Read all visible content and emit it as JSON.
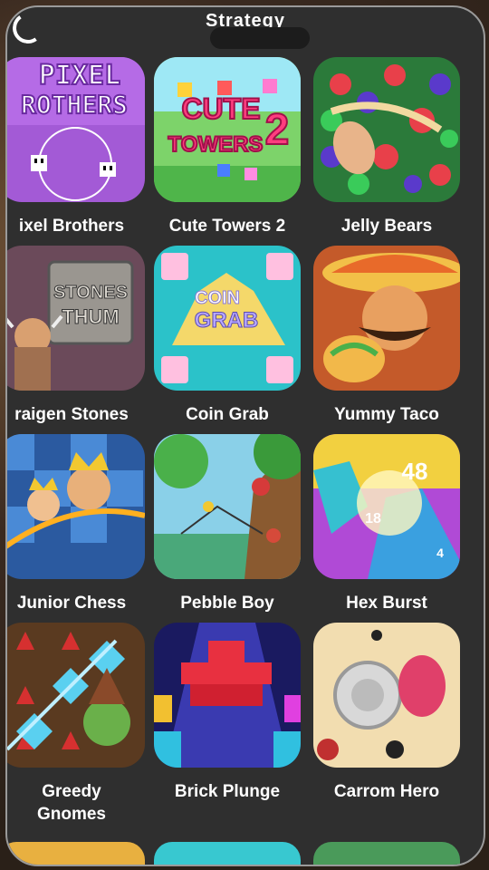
{
  "header": {
    "title": "Strategy"
  },
  "games": [
    {
      "name": "Pixel Brothers",
      "label": "ixel Brothers",
      "art_text": [
        "PIXEL",
        "ROTHERS"
      ]
    },
    {
      "name": "Cute Towers 2",
      "label": "Cute Towers 2",
      "art_text": [
        "CUTE",
        "TOWERS",
        "2"
      ]
    },
    {
      "name": "Jelly Bears",
      "label": "Jelly Bears"
    },
    {
      "name": "Kraigen Stones",
      "label": "raigen Stones",
      "art_text": [
        "STONES",
        "THUM"
      ]
    },
    {
      "name": "Coin Grab",
      "label": "Coin Grab",
      "art_text": [
        "COIN",
        "GRAB"
      ]
    },
    {
      "name": "Yummy Taco",
      "label": "Yummy Taco"
    },
    {
      "name": "Junior Chess",
      "label": "Junior Chess"
    },
    {
      "name": "Pebble Boy",
      "label": "Pebble Boy"
    },
    {
      "name": "Hex Burst",
      "label": "Hex Burst",
      "art_text": [
        "48",
        "18",
        "4"
      ]
    },
    {
      "name": "Greedy Gnomes",
      "label": "Greedy\nGnomes"
    },
    {
      "name": "Brick Plunge",
      "label": "Brick Plunge"
    },
    {
      "name": "Carrom Hero",
      "label": "Carrom Hero"
    }
  ]
}
